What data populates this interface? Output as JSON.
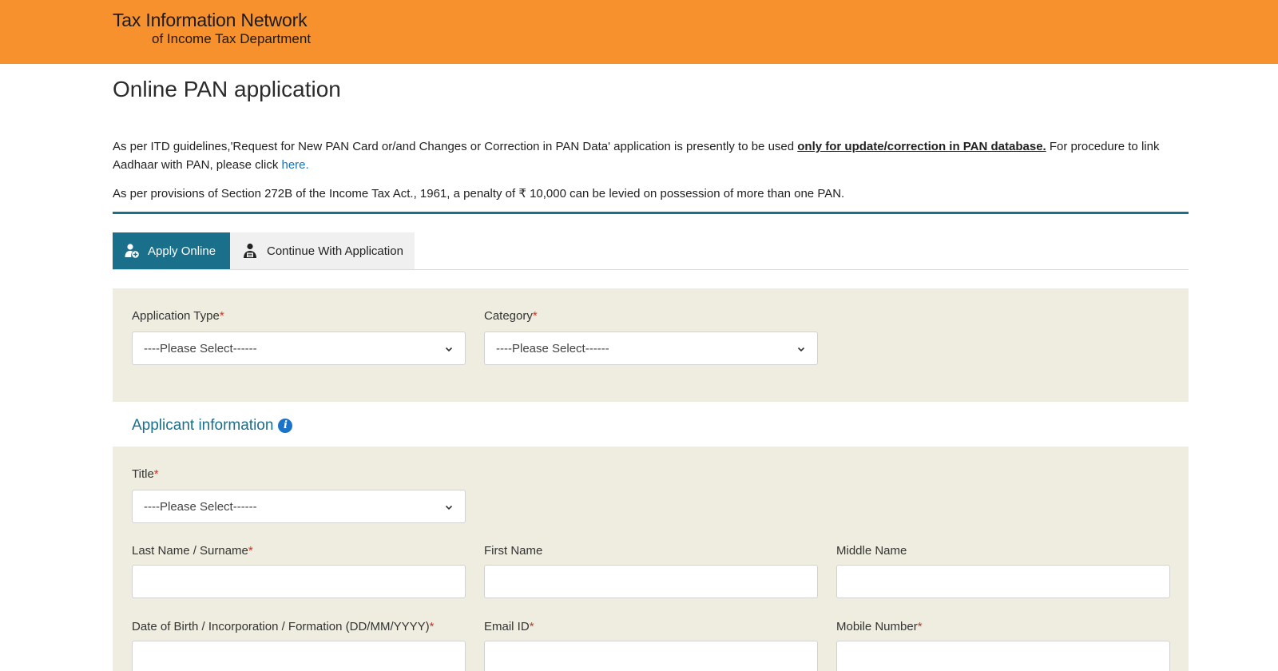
{
  "header": {
    "logo_line1": "Tax Information Network",
    "logo_line2": "of Income Tax Department",
    "color": "#f6912d"
  },
  "page_title": "Online PAN application",
  "notice": {
    "para1_pre": "As per ITD guidelines,'Request for New PAN Card or/and Changes or Correction in PAN Data' application is presently to be used ",
    "para1_bold": "only for update/correction in PAN database.",
    "para1_post": " For procedure to link Aadhaar with PAN, please click ",
    "para1_link": "here.",
    "para2": "As per provisions of Section 272B of the Income Tax Act., 1961, a penalty of ₹ 10,000 can be levied on possession of more than one PAN."
  },
  "tabs": [
    {
      "label": "Apply Online",
      "icon": "user-add-icon",
      "active": true
    },
    {
      "label": "Continue With Application",
      "icon": "user-form-icon",
      "active": false
    }
  ],
  "application": {
    "type_label": "Application Type",
    "type_value": "----Please Select------",
    "category_label": "Category",
    "category_value": "----Please Select------"
  },
  "applicant": {
    "section_title": "Applicant information",
    "title_label": "Title",
    "title_value": "----Please Select------",
    "last_name_label": "Last Name / Surname",
    "first_name_label": "First Name",
    "middle_name_label": "Middle Name",
    "dob_label": "Date of Birth / Incorporation / Formation (DD/MM/YYYY)",
    "email_label": "Email ID",
    "mobile_label": "Mobile Number"
  },
  "required_mark": "*",
  "colors": {
    "accent": "#1a6f8b",
    "panel_bg": "#efede0",
    "link": "#1a73b8",
    "required": "#c0392b"
  }
}
